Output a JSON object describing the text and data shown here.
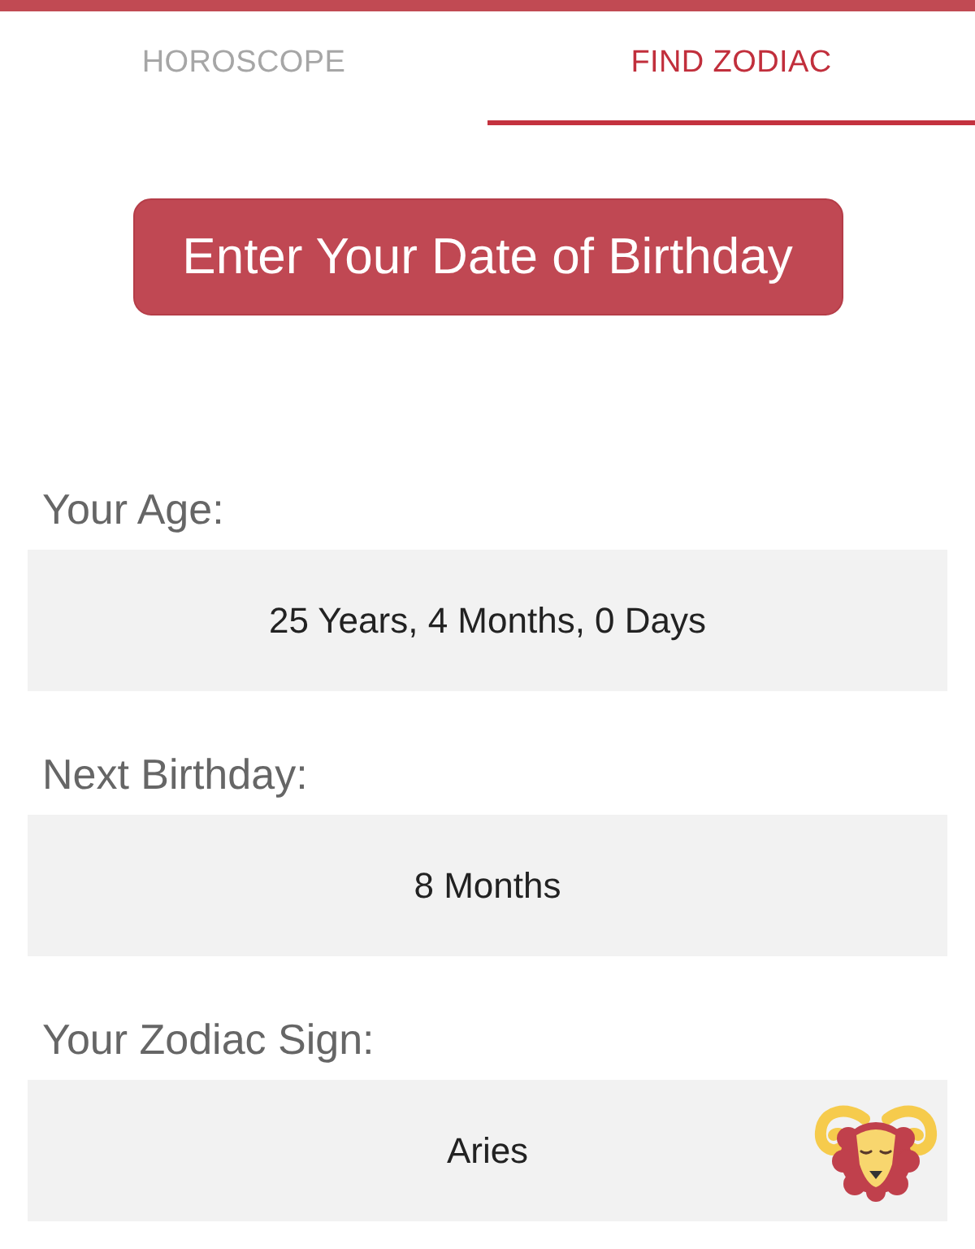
{
  "tabs": [
    {
      "label": "HOROSCOPE",
      "selected": false
    },
    {
      "label": "FIND ZODIAC",
      "selected": true
    }
  ],
  "birthday_button": {
    "label": "Enter Your Date of Birthday"
  },
  "results": [
    {
      "kind": "text",
      "label": "Your Age:",
      "value": "25 Years, 4 Months, 0 Days"
    },
    {
      "kind": "text",
      "label": "Next Birthday:",
      "value": "8 Months"
    },
    {
      "kind": "zodiac",
      "label": "Your Zodiac Sign:",
      "value": "Aries"
    }
  ]
}
